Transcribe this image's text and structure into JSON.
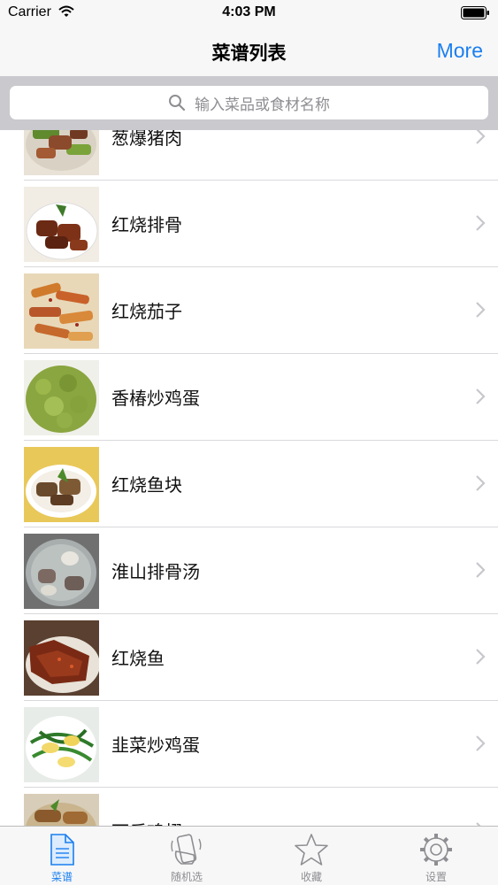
{
  "status_bar": {
    "carrier": "Carrier",
    "time": "4:03 PM"
  },
  "nav": {
    "title": "菜谱列表",
    "more": "More"
  },
  "search": {
    "placeholder": "输入菜品或食材名称"
  },
  "recipes": [
    {
      "name": "葱爆猪肉",
      "image": "stir-fried-pork-scallion"
    },
    {
      "name": "红烧排骨",
      "image": "braised-spare-ribs"
    },
    {
      "name": "红烧茄子",
      "image": "braised-eggplant"
    },
    {
      "name": "香椿炒鸡蛋",
      "image": "toona-scrambled-egg"
    },
    {
      "name": "红烧鱼块",
      "image": "braised-fish-pieces"
    },
    {
      "name": "淮山排骨汤",
      "image": "yam-rib-soup"
    },
    {
      "name": "红烧鱼",
      "image": "braised-fish"
    },
    {
      "name": "韭菜炒鸡蛋",
      "image": "chive-scrambled-egg"
    },
    {
      "name": "可乐鸡翅",
      "image": "cola-chicken-wings"
    }
  ],
  "tabs": [
    {
      "label": "菜谱",
      "icon": "document-icon",
      "active": true
    },
    {
      "label": "随机选",
      "icon": "shake-phone-icon",
      "active": false
    },
    {
      "label": "收藏",
      "icon": "star-icon",
      "active": false
    },
    {
      "label": "设置",
      "icon": "gear-icon",
      "active": false
    }
  ],
  "colors": {
    "accent": "#1a7ff0",
    "inactive": "#8e8e93",
    "bar_bg": "#f7f7f7",
    "search_bg": "#c9c9ce"
  }
}
